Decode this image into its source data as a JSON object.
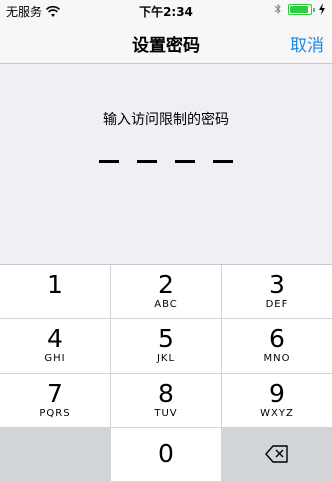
{
  "status_bar": {
    "carrier": "无服务",
    "time": "下午2:34",
    "battery_level": 0.9
  },
  "nav": {
    "title": "设置密码",
    "cancel_label": "取消"
  },
  "prompt": "输入访问限制的密码",
  "passcode_length": 4,
  "keypad": [
    {
      "number": "1",
      "letters": ""
    },
    {
      "number": "2",
      "letters": "ABC"
    },
    {
      "number": "3",
      "letters": "DEF"
    },
    {
      "number": "4",
      "letters": "GHI"
    },
    {
      "number": "5",
      "letters": "JKL"
    },
    {
      "number": "6",
      "letters": "MNO"
    },
    {
      "number": "7",
      "letters": "PQRS"
    },
    {
      "number": "8",
      "letters": "TUV"
    },
    {
      "number": "9",
      "letters": "WXYZ"
    },
    {
      "number": "0",
      "letters": ""
    }
  ],
  "colors": {
    "accent": "#1e88e5",
    "battery": "#2ecc40",
    "background": "#efeff4"
  },
  "icons": [
    "wifi-icon",
    "bluetooth-icon",
    "battery-icon",
    "charging-icon",
    "delete-icon"
  ]
}
